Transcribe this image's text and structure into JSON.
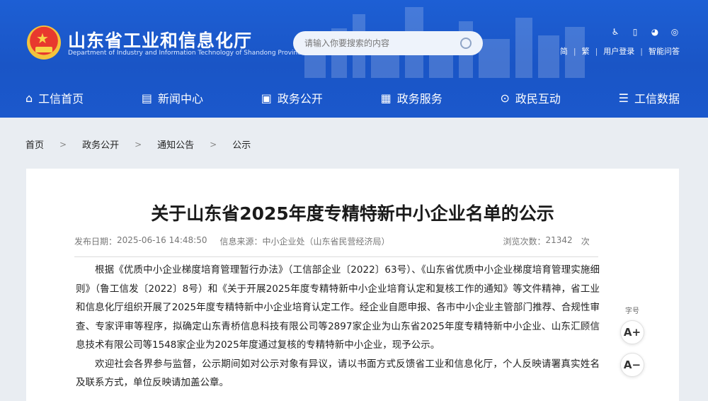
{
  "header": {
    "site_title": "山东省工业和信息化厅",
    "site_subtitle": "Department of Industry and Information Technology of Shandong Province",
    "search_placeholder": "请输入你要搜索的内容",
    "tool_icons": [
      "accessibility-icon",
      "mobile-icon",
      "wechat-icon",
      "weibo-icon"
    ],
    "links": [
      "简",
      "繁",
      "用户登录",
      "智能问答"
    ]
  },
  "nav": [
    {
      "label": "工信首页",
      "icon": "home-icon"
    },
    {
      "label": "新闻中心",
      "icon": "news-icon"
    },
    {
      "label": "政务公开",
      "icon": "monitor-icon"
    },
    {
      "label": "政务服务",
      "icon": "service-icon"
    },
    {
      "label": "政民互动",
      "icon": "chat-icon"
    },
    {
      "label": "工信数据",
      "icon": "database-icon"
    }
  ],
  "breadcrumb": [
    "首页",
    "政务公开",
    "通知公告",
    "公示"
  ],
  "article": {
    "title": "关于山东省2025年度专精特新中小企业名单的公示",
    "publish_label": "发布日期：",
    "publish_date": "2025-06-16 14:48:50",
    "source_label": "信息来源：",
    "source": "中小企业处（山东省民营经济局）",
    "views_label": "浏览次数：",
    "views": "21342",
    "views_unit": "次",
    "paragraphs": [
      "根据《优质中小企业梯度培育管理暂行办法》（工信部企业〔2022〕63号）、《山东省优质中小企业梯度培育管理实施细则》（鲁工信发〔2022〕8号）和《关于开展2025年度专精特新中小企业培育认定和复核工作的通知》等文件精神，省工业和信息化厅组织开展了2025年度专精特新中小企业培育认定工作。经企业自愿申报、各市中小企业主管部门推荐、合规性审查、专家评审等程序，拟确定山东青桥信息科技有限公司等2897家企业为山东省2025年度专精特新中小企业、山东汇顾信息技术有限公司等1548家企业为2025年度通过复核的专精特新中小企业，现予公示。",
      "欢迎社会各界参与监督，公示期间如对公示对象有异议，请以书面方式反馈省工业和信息化厅，个人反映请署真实姓名及联系方式，单位反映请加盖公章。"
    ]
  },
  "font_control": {
    "label": "字号",
    "increase": "A+",
    "decrease": "A−"
  },
  "colors": {
    "header_blue": "#1a55c6",
    "background": "#e9edf2"
  }
}
